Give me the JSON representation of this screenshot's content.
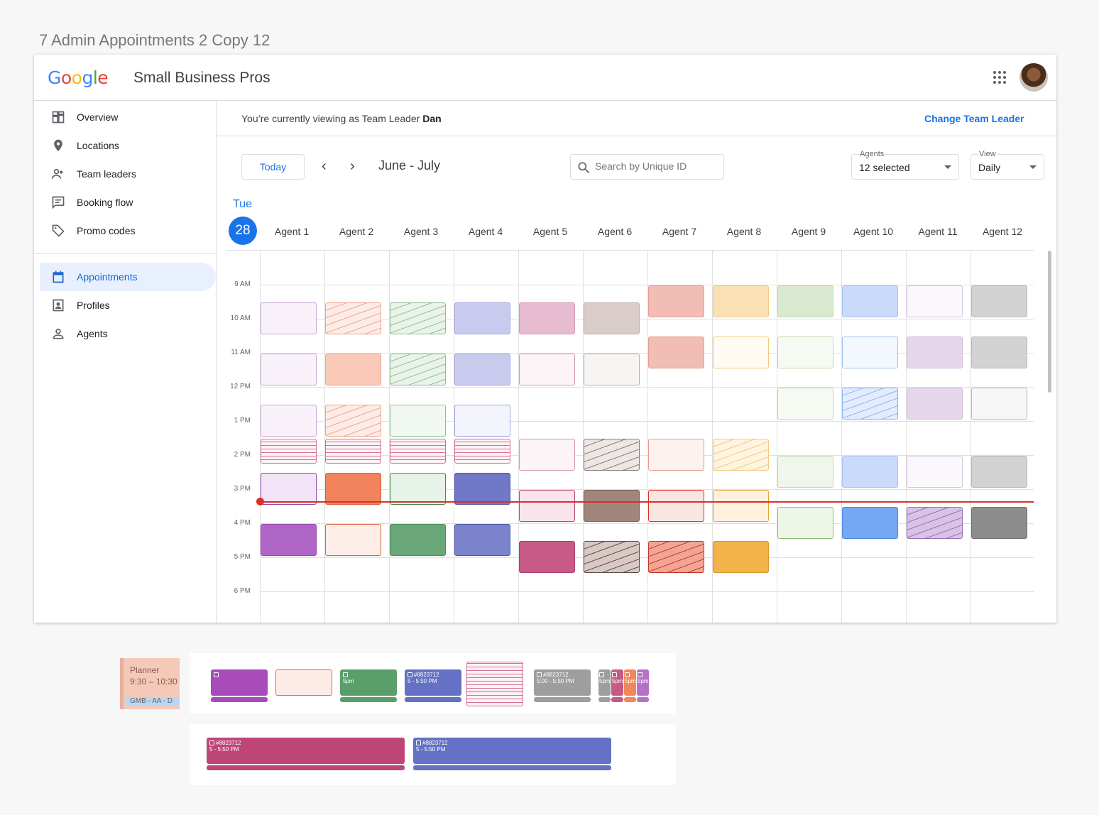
{
  "frame_label": "7 Admin Appointments 2 Copy 12",
  "app": {
    "logo": "Google",
    "name": "Small Business Pros"
  },
  "sidebar": {
    "items": [
      {
        "label": "Overview",
        "icon": "dashboard-icon"
      },
      {
        "label": "Locations",
        "icon": "location-pin-icon"
      },
      {
        "label": "Team leaders",
        "icon": "team-icon"
      },
      {
        "label": "Booking flow",
        "icon": "booking-icon"
      },
      {
        "label": "Promo codes",
        "icon": "tag-icon"
      },
      {
        "label": "Appointments",
        "icon": "calendar-icon",
        "active": true
      },
      {
        "label": "Profiles",
        "icon": "profile-icon"
      },
      {
        "label": "Agents",
        "icon": "person-icon"
      }
    ]
  },
  "banner": {
    "prefix": "You’re currently viewing as Team Leader ",
    "leader": "Dan",
    "change_label": "Change Team Leader"
  },
  "toolbar": {
    "today_label": "Today",
    "prev_label": "‹",
    "next_label": "›",
    "range": "June - July",
    "search_placeholder": "Search by Unique ID",
    "agents_label": "Agents",
    "agents_value": "12 selected",
    "view_label": "View",
    "view_value": "Daily"
  },
  "day": {
    "name": "Tue",
    "number": "28"
  },
  "agents": [
    "Agent 1",
    "Agent 2",
    "Agent 3",
    "Agent 4",
    "Agent 5",
    "Agent 6",
    "Agent 7",
    "Agent 8",
    "Agent 9",
    "Agent 10",
    "Agent 11",
    "Agent 12"
  ],
  "times": [
    "9 AM",
    "10 AM",
    "11 AM",
    "12 PM",
    "1 PM",
    "2 PM",
    "3 PM",
    "4 PM",
    "5 PM",
    "6 PM"
  ],
  "legend": {
    "planner_title": "Planner",
    "planner_time": "9:30 – 10:30",
    "planner_tag": "GMB - AA - D",
    "card_id": "#8823712",
    "time_5pm": "5pm",
    "time_range_a": "5 - 5:50 PM",
    "time_range_b": "5:00 - 5:50 PM"
  },
  "colors": {
    "accent": "#1a73e8",
    "now": "#d93025"
  }
}
